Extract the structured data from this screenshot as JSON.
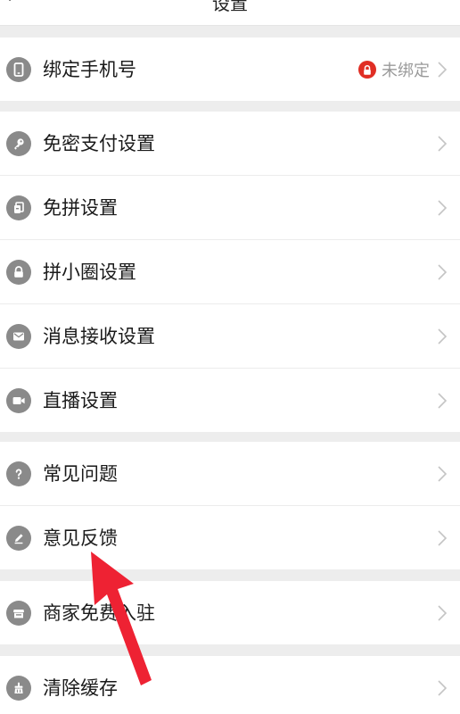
{
  "header": {
    "title": "设置"
  },
  "groups": [
    {
      "items": [
        {
          "label": "绑定手机号",
          "icon": "phone-icon",
          "status": "未绑定"
        }
      ]
    },
    {
      "items": [
        {
          "label": "免密支付设置",
          "icon": "key-icon"
        },
        {
          "label": "免拼设置",
          "icon": "cards-icon"
        },
        {
          "label": "拼小圈设置",
          "icon": "lock-icon"
        },
        {
          "label": "消息接收设置",
          "icon": "mail-icon"
        },
        {
          "label": "直播设置",
          "icon": "video-icon"
        }
      ]
    },
    {
      "items": [
        {
          "label": "常见问题",
          "icon": "question-icon"
        },
        {
          "label": "意见反馈",
          "icon": "pencil-icon"
        }
      ]
    },
    {
      "items": [
        {
          "label": "商家免费入驻",
          "icon": "store-icon"
        }
      ]
    },
    {
      "items": [
        {
          "label": "清除缓存",
          "icon": "broom-icon"
        }
      ]
    }
  ],
  "colors": {
    "accent": "#e02e24",
    "icon_gray": "#8a8a8a",
    "background": "#ededed",
    "annotation_arrow": "#ee2233"
  }
}
